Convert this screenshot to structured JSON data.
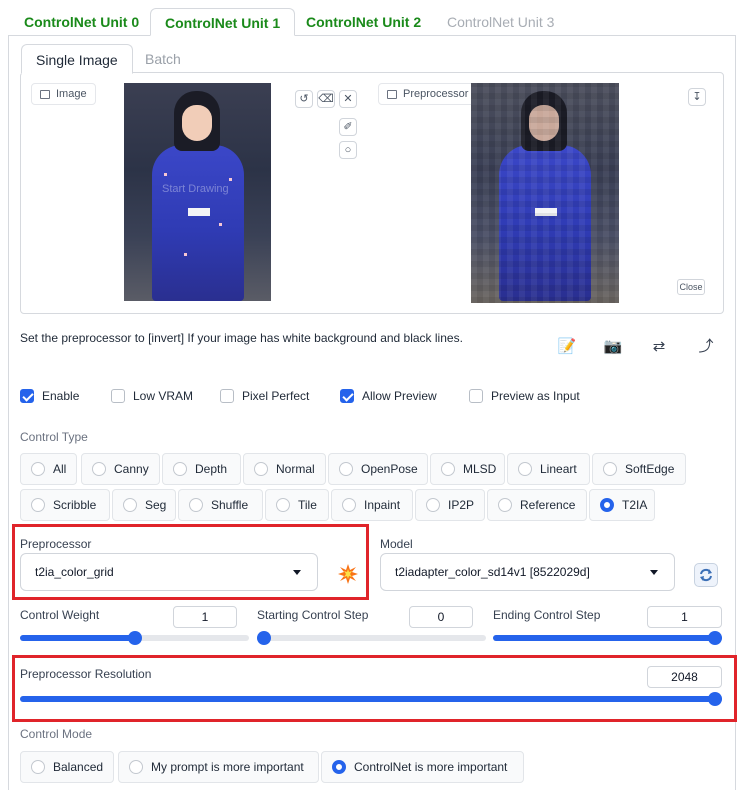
{
  "unit_tabs": [
    {
      "label": "ControlNet Unit 0"
    },
    {
      "label": "ControlNet Unit 1"
    },
    {
      "label": "ControlNet Unit 2"
    },
    {
      "label": "ControlNet Unit 3"
    }
  ],
  "image_tabs": [
    {
      "label": "Single Image"
    },
    {
      "label": "Batch"
    }
  ],
  "image_panel": {
    "image_label": "Image",
    "preview_label": "Preprocessor Preview",
    "watermark": "Start Drawing",
    "close_label": "Close",
    "tool_icons": [
      "undo-icon",
      "eraser-icon",
      "close-icon",
      "brush-icon",
      "palette-icon",
      "download-icon"
    ]
  },
  "hint_text": "Set the preprocessor to [invert] If your image has white background and black lines.",
  "action_icons": [
    "edit-icon",
    "camera-icon",
    "swap-icon",
    "upload-arrow-icon"
  ],
  "checkboxes": [
    {
      "label": "Enable",
      "checked": true
    },
    {
      "label": "Low VRAM",
      "checked": false
    },
    {
      "label": "Pixel Perfect",
      "checked": false
    },
    {
      "label": "Allow Preview",
      "checked": true
    },
    {
      "label": "Preview as Input",
      "checked": false
    }
  ],
  "control_type": {
    "label": "Control Type",
    "row1": [
      "All",
      "Canny",
      "Depth",
      "Normal",
      "OpenPose",
      "MLSD",
      "Lineart",
      "SoftEdge"
    ],
    "row2": [
      "Scribble",
      "Seg",
      "Shuffle",
      "Tile",
      "Inpaint",
      "IP2P",
      "Reference",
      "T2IA"
    ],
    "selected": "T2IA"
  },
  "preprocessor": {
    "label": "Preprocessor",
    "value": "t2ia_color_grid"
  },
  "model": {
    "label": "Model",
    "value": "t2iadapter_color_sd14v1 [8522029d]"
  },
  "sliders": {
    "control_weight": {
      "label": "Control Weight",
      "value": "1",
      "fraction": 0.5
    },
    "starting_step": {
      "label": "Starting Control Step",
      "value": "0",
      "fraction": 0.0
    },
    "ending_step": {
      "label": "Ending Control Step",
      "value": "1",
      "fraction": 1.0
    },
    "resolution": {
      "label": "Preprocessor Resolution",
      "value": "2048",
      "fraction": 1.0
    }
  },
  "control_mode": {
    "label": "Control Mode",
    "options": [
      "Balanced",
      "My prompt is more important",
      "ControlNet is more important"
    ],
    "selected": "ControlNet is more important"
  },
  "colors": {
    "accent": "#2563eb",
    "tab_green": "#1a8a1a",
    "highlight_red": "#e0242a"
  }
}
